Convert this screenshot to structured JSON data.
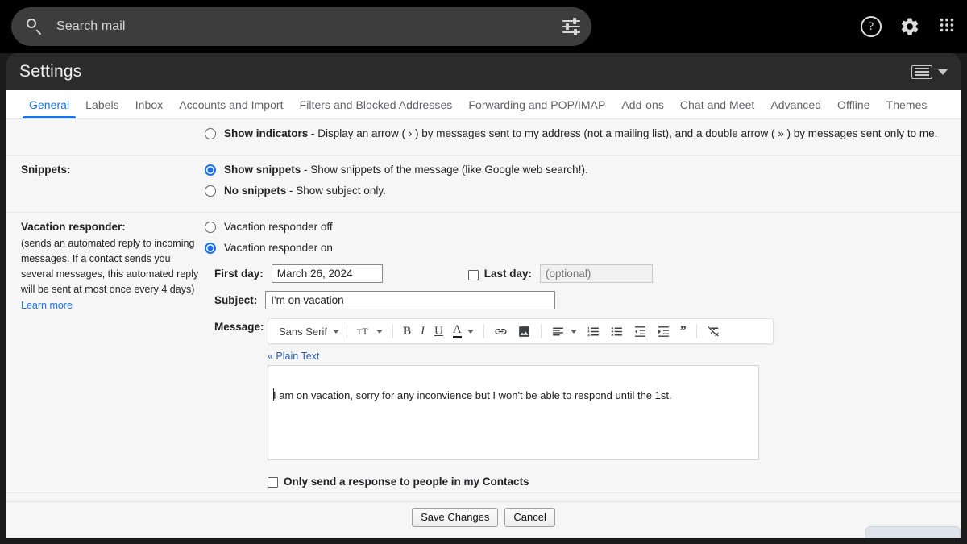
{
  "topbar": {
    "search_placeholder": "Search mail",
    "search_value": "",
    "icons": {
      "search": "search-icon",
      "tune": "tune-icon",
      "help": "help-icon",
      "help_glyph": "?",
      "settings": "gear-icon",
      "apps": "apps-grid-icon"
    }
  },
  "settings": {
    "title": "Settings",
    "density_icon": "display-density-icon"
  },
  "tabs": [
    {
      "label": "General",
      "active": true
    },
    {
      "label": "Labels",
      "active": false
    },
    {
      "label": "Inbox",
      "active": false
    },
    {
      "label": "Accounts and Import",
      "active": false
    },
    {
      "label": "Filters and Blocked Addresses",
      "active": false
    },
    {
      "label": "Forwarding and POP/IMAP",
      "active": false
    },
    {
      "label": "Add-ons",
      "active": false
    },
    {
      "label": "Chat and Meet",
      "active": false
    },
    {
      "label": "Advanced",
      "active": false
    },
    {
      "label": "Offline",
      "active": false
    },
    {
      "label": "Themes",
      "active": false
    }
  ],
  "personal_indicators": {
    "option": {
      "bold": "Show indicators",
      "rest": " - Display an arrow ( › ) by messages sent to my address (not a mailing list), and a double arrow ( » ) by messages sent only to me.",
      "selected": false
    }
  },
  "snippets": {
    "label": "Snippets:",
    "options": [
      {
        "bold": "Show snippets",
        "rest": " - Show snippets of the message (like Google web search!).",
        "selected": true
      },
      {
        "bold": "No snippets",
        "rest": " - Show subject only.",
        "selected": false
      }
    ]
  },
  "vacation": {
    "label": "Vacation responder:",
    "note": "(sends an automated reply to incoming messages. If a contact sends you several messages, this automated reply will be sent at most once every 4 days)",
    "learn_more": "Learn more",
    "off_label": "Vacation responder off",
    "on_label": "Vacation responder on",
    "off_selected": false,
    "on_selected": true,
    "first_day_label": "First day:",
    "first_day_value": "March 26, 2024",
    "last_day_label": "Last day:",
    "last_day_checked": false,
    "last_day_placeholder": "(optional)",
    "last_day_value": "",
    "subject_label": "Subject:",
    "subject_value": "I'm on vacation",
    "message_label": "Message:",
    "plain_text_link": "« Plain Text",
    "message_value": "I am on vacation, sorry for any inconvience but I won't be able to respond until the 1st.",
    "contacts_only_label": "Only send a response to people in my Contacts",
    "contacts_only_checked": false
  },
  "editor_toolbar": {
    "font_name": "Sans Serif",
    "items": [
      "font-family-dropdown",
      "font-size-icon",
      "bold-icon",
      "italic-icon",
      "underline-icon",
      "text-color-icon",
      "insert-link-icon",
      "insert-image-icon",
      "align-icon",
      "numbered-list-icon",
      "bulleted-list-icon",
      "outdent-icon",
      "indent-icon",
      "quote-icon",
      "remove-formatting-icon"
    ]
  },
  "footer": {
    "save_label": "Save Changes",
    "cancel_label": "Cancel"
  },
  "colors": {
    "accent": "#1a73e8",
    "topbar_bg": "#000000",
    "header_bg": "#2b2b2b",
    "panel_bg": "#f6f6f6",
    "link": "#2a5db0"
  }
}
